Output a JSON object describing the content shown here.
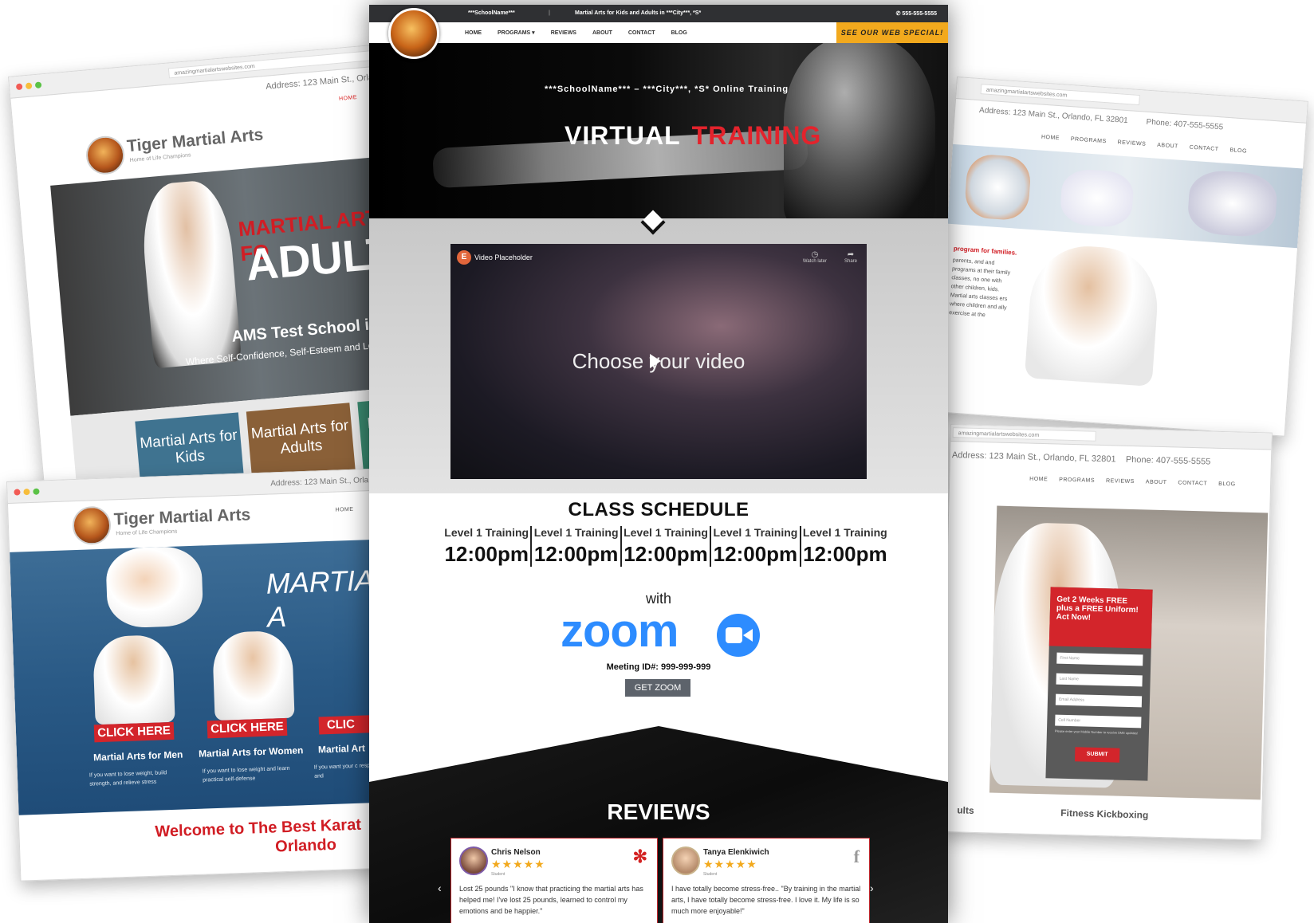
{
  "bg_left_top": {
    "url": "amazingmartialartswebsites.com",
    "address": "Address: 123 Main St., Orla",
    "nav_home": "HOME",
    "brand": "Tiger Martial Arts",
    "tagline": "Home of Life Champions",
    "banner_red": "MARTIAL ARTS FO",
    "banner_big": "ADULT",
    "school": "AMS Test School in",
    "school_sub": "Where Self-Confidence, Self-Esteem and Lea",
    "tiles": [
      "Martial Arts for Kids",
      "Martial Arts for Adults",
      "M fo"
    ]
  },
  "bg_left_bottom": {
    "address": "Address: 123 Main St., Orla",
    "brand": "Tiger Martial Arts",
    "tagline": "Home of Life Champions",
    "nav_home": "HOME",
    "banner": "MARTIAL A",
    "cta": "CLICK HERE",
    "cta3": "CLIC",
    "programs": [
      {
        "title": "Martial Arts for Men",
        "desc": "If you want to lose weight, build strength, and relieve stress"
      },
      {
        "title": "Martial Arts for Women",
        "desc": "If you want to lose weight and learn practical self-defense"
      },
      {
        "title": "Martial Art",
        "desc": "If you want your c respect and"
      }
    ],
    "welcome": "Welcome to The Best Karat",
    "welcome2": "Orlando"
  },
  "bg_right_top": {
    "url": "amazingmartialartswebsites.com",
    "address": "Address: 123 Main St., Orlando, FL 32801",
    "phone": "Phone: 407-555-5555",
    "nav": [
      "HOME",
      "PROGRAMS",
      "REVIEWS",
      "ABOUT",
      "CONTACT",
      "BLOG"
    ],
    "text_red": "program for families.",
    "text_body": "parents, and and programs at their family classes, no one with other children, kids. Martial arts classes ers where children and ally exercise at the"
  },
  "bg_right_bottom": {
    "url": "amazingmartialartswebsites.com",
    "address": "Address: 123 Main St., Orlando, FL 32801",
    "phone": "Phone: 407-555-5555",
    "nav": [
      "HOME",
      "PROGRAMS",
      "REVIEWS",
      "ABOUT",
      "CONTACT",
      "BLOG"
    ],
    "offer": "Get 2 Weeks FREE plus a FREE Uniform! Act Now!",
    "fields": [
      "First Name",
      "Last Name",
      "Email Address",
      "Cell Number"
    ],
    "note": "Please enter your Mobile Number to receive SMS updates!",
    "submit": "SUBMIT",
    "footer_left": "ults",
    "footer_right": "Fitness Kickboxing"
  },
  "main": {
    "top_school": "***SchoolName***",
    "top_tagline": "Martial Arts for Kids and Adults in ***City***, *S*",
    "top_phone": "555-555-5555",
    "nav": [
      "HOME",
      "PROGRAMS ▾",
      "REVIEWS",
      "ABOUT",
      "CONTACT",
      "BLOG"
    ],
    "special": "SEE OUR WEB SPECIAL!",
    "hero_sub": "***SchoolName*** – ***City***, *S* Online Training",
    "hero_title_white": "VIRTUAL",
    "hero_title_red": "TRAINING",
    "video_label": "Video Placeholder",
    "video_watch": "Watch later",
    "video_share": "Share",
    "video_text": "Choose your video",
    "schedule_title": "CLASS SCHEDULE",
    "schedule": [
      {
        "level": "Level 1 Training",
        "time": "12:00pm"
      },
      {
        "level": "Level 1 Training",
        "time": "12:00pm"
      },
      {
        "level": "Level 1 Training",
        "time": "12:00pm"
      },
      {
        "level": "Level 1 Training",
        "time": "12:00pm"
      },
      {
        "level": "Level 1 Training",
        "time": "12:00pm"
      }
    ],
    "with": "with",
    "zoom": "zoom",
    "meeting_id": "Meeting ID#: 999-999-999",
    "get_zoom": "GET ZOOM",
    "reviews_title": "REVIEWS",
    "reviews": [
      {
        "name": "Chris Nelson",
        "stars": "★★★★★",
        "role": "Student",
        "text": "Lost 25 pounds \"I know that practicing the martial arts has helped me! I've lost 25 pounds, learned to control my emotions and be happier.\"",
        "source_icon": "yelp-icon"
      },
      {
        "name": "Tanya Elenkiwich",
        "stars": "★★★★★",
        "role": "Student",
        "text": "I have totally become stress-free.. \"By training in the martial arts, I have totally become stress-free. I love it. My life is so much more enjoyable!\"",
        "source_icon": "facebook-icon"
      }
    ]
  }
}
